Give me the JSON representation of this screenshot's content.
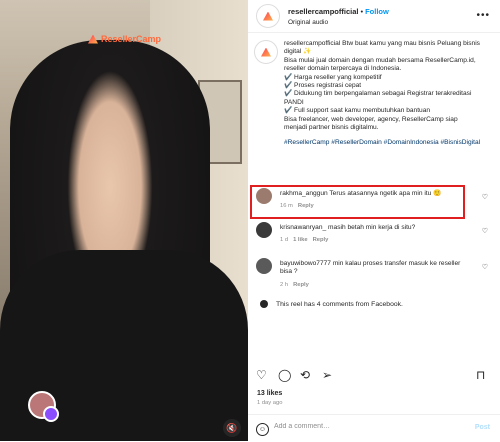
{
  "media": {
    "watermark": "ResellerCamp"
  },
  "header": {
    "username": "resellercampofficial",
    "separator": "•",
    "follow_label": "Follow",
    "audio": "Original audio",
    "more_icon": "more-horizontal-icon"
  },
  "caption": {
    "lines": [
      "resellercampofficial Btw buat kamu yang mau bisnis Peluang bisnis",
      "digital ✨",
      "Bisa mulai jual domain dengan mudah bersama ResellerCamp.id,",
      "reseller domain terpercaya di Indonesia.",
      "✔️ Harga reseller yang kompetitif",
      "✔️ Proses registrasi cepat",
      "✔️ Didukung tim berpengalaman sebagai Registrar terakreditasi",
      "PANDI",
      "✔️ Full support saat kamu membutuhkan bantuan",
      "Bisa freelancer, web developer, agency, ResellerCamp siap",
      "menjadi partner bisnis digitalmu."
    ],
    "hashtags": "#ResellerCamp #ResellerDomain #DomainIndonesia #BisnisDigital"
  },
  "comments": [
    {
      "username": "rakhma_anggun",
      "text": "Terus atasannya ngetik apa min itu 🙂",
      "text2": "",
      "time": "16 m",
      "likes": "",
      "reply": "Reply",
      "avatar_color": "#9b7b6e"
    },
    {
      "username": "krisnawanryan_",
      "text": "masih betah min kerja di situ?",
      "text2": "",
      "time": "1 d",
      "likes": "1 like",
      "reply": "Reply",
      "avatar_color": "#3a3a3a"
    },
    {
      "username": "bayuwibowo7777",
      "text": "min kalau proses transfer masuk ke reseller",
      "text2": "bisa ?",
      "time": "2 h",
      "likes": "",
      "reply": "Reply",
      "avatar_color": "#5a5a5a"
    }
  ],
  "fb_note": "This reel has 4 comments from Facebook.",
  "actions": {
    "like_icon": "heart-icon",
    "comment_icon": "comment-icon",
    "repost_icon": "repost-icon",
    "share_icon": "share-icon",
    "save_icon": "bookmark-icon"
  },
  "likes": "13 likes",
  "posted": "1 day ago",
  "add_comment": {
    "placeholder": "Add a comment…",
    "post_label": "Post"
  },
  "colors": {
    "accent": "#0095f6",
    "highlight": "#e02020",
    "hashtag": "#00376b"
  }
}
